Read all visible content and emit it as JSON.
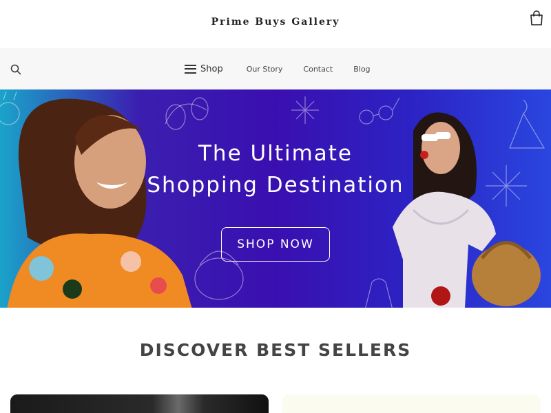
{
  "header": {
    "brand": "Prime Buys Gallery",
    "cart_icon": "shopping-bag-icon"
  },
  "nav": {
    "search_icon": "search-icon",
    "shop_label": "Shop",
    "links": [
      "Our Story",
      "Contact",
      "Blog"
    ]
  },
  "hero": {
    "title_line1": "The Ultimate",
    "title_line2": "Shopping Destination",
    "cta_label": "SHOP NOW",
    "colors": {
      "gradient_left": "#1aa3c9",
      "gradient_mid": "#3a0fb0",
      "gradient_right": "#2a46df"
    }
  },
  "section": {
    "title": "DISCOVER BEST SELLERS"
  }
}
